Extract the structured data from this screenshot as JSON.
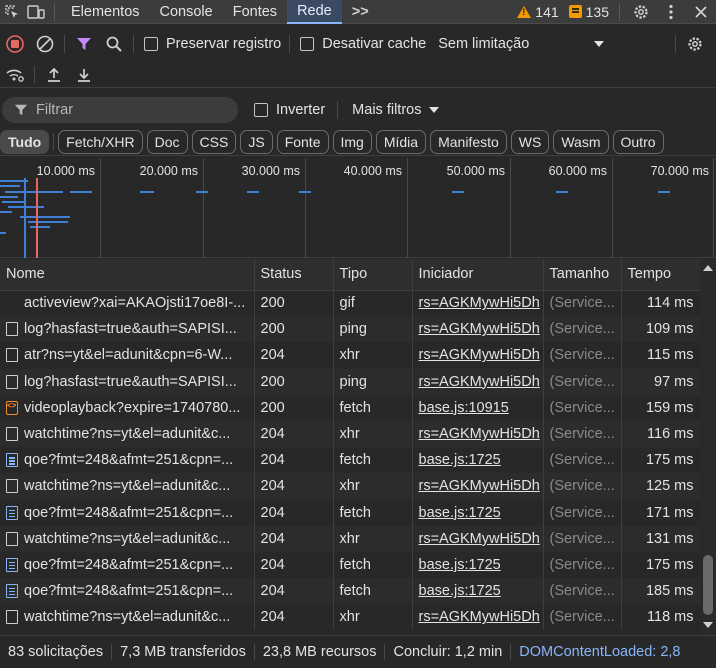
{
  "tabbar": {
    "tabs": [
      "Elementos",
      "Console",
      "Fontes",
      "Rede"
    ],
    "active_tab": "Rede",
    "more_tabs_symbol": ">>",
    "warnings_count": "141",
    "issues_count": "135"
  },
  "toolbar": {
    "preserve_log_label": "Preservar registro",
    "disable_cache_label": "Desativar cache",
    "throttling_value": "Sem limitação"
  },
  "filterbar": {
    "filter_placeholder": "Filtrar",
    "invert_label": "Inverter",
    "more_filters_label": "Mais filtros"
  },
  "type_filters": [
    "Tudo",
    "Fetch/XHR",
    "Doc",
    "CSS",
    "JS",
    "Fonte",
    "Img",
    "Mídia",
    "Manifesto",
    "WS",
    "Wasm",
    "Outro"
  ],
  "active_type_filter": "Tudo",
  "overview": {
    "tick_labels": [
      "10.000 ms",
      "20.000 ms",
      "30.000 ms",
      "40.000 ms",
      "50.000 ms",
      "60.000 ms",
      "70.000 ms"
    ]
  },
  "table": {
    "columns": [
      "Nome",
      "Status",
      "Tipo",
      "Iniciador",
      "Tamanho",
      "Tempo"
    ],
    "rows": [
      {
        "icon": "none",
        "name": "activeview?xai=AKAOjsti17oe8I-...",
        "status": "200",
        "type": "gif",
        "initiator": "rs=AGKMywHi5Dh",
        "size": "(Service...",
        "time": "114 ms"
      },
      {
        "icon": "file",
        "name": "log?hasfast=true&auth=SAPISI...",
        "status": "200",
        "type": "ping",
        "initiator": "rs=AGKMywHi5Dh",
        "size": "(Service...",
        "time": "109 ms"
      },
      {
        "icon": "file",
        "name": "atr?ns=yt&el=adunit&cpn=6-W...",
        "status": "204",
        "type": "xhr",
        "initiator": "rs=AGKMywHi5Dh",
        "size": "(Service...",
        "time": "115 ms"
      },
      {
        "icon": "file",
        "name": "log?hasfast=true&auth=SAPISI...",
        "status": "200",
        "type": "ping",
        "initiator": "rs=AGKMywHi5Dh",
        "size": "(Service...",
        "time": "97 ms"
      },
      {
        "icon": "media",
        "name": "videoplayback?expire=1740780...",
        "status": "200",
        "type": "fetch",
        "initiator": "base.js:10915",
        "size": "(Service...",
        "time": "159 ms"
      },
      {
        "icon": "file",
        "name": "watchtime?ns=yt&el=adunit&c...",
        "status": "204",
        "type": "xhr",
        "initiator": "rs=AGKMywHi5Dh",
        "size": "(Service...",
        "time": "116 ms"
      },
      {
        "icon": "doc",
        "name": "qoe?fmt=248&afmt=251&cpn=...",
        "status": "204",
        "type": "fetch",
        "initiator": "base.js:1725",
        "size": "(Service...",
        "time": "175 ms"
      },
      {
        "icon": "file",
        "name": "watchtime?ns=yt&el=adunit&c...",
        "status": "204",
        "type": "xhr",
        "initiator": "rs=AGKMywHi5Dh",
        "size": "(Service...",
        "time": "125 ms"
      },
      {
        "icon": "doc",
        "name": "qoe?fmt=248&afmt=251&cpn=...",
        "status": "204",
        "type": "fetch",
        "initiator": "base.js:1725",
        "size": "(Service...",
        "time": "171 ms"
      },
      {
        "icon": "file",
        "name": "watchtime?ns=yt&el=adunit&c...",
        "status": "204",
        "type": "xhr",
        "initiator": "rs=AGKMywHi5Dh",
        "size": "(Service...",
        "time": "131 ms"
      },
      {
        "icon": "doc",
        "name": "qoe?fmt=248&afmt=251&cpn=...",
        "status": "204",
        "type": "fetch",
        "initiator": "base.js:1725",
        "size": "(Service...",
        "time": "175 ms"
      },
      {
        "icon": "doc",
        "name": "qoe?fmt=248&afmt=251&cpn=...",
        "status": "204",
        "type": "fetch",
        "initiator": "base.js:1725",
        "size": "(Service...",
        "time": "185 ms"
      },
      {
        "icon": "file",
        "name": "watchtime?ns=yt&el=adunit&c...",
        "status": "204",
        "type": "xhr",
        "initiator": "rs=AGKMywHi5Dh",
        "size": "(Service...",
        "time": "118 ms"
      }
    ]
  },
  "statusbar": {
    "requests": "83 solicitações",
    "transferred": "7,3 MB transferidos",
    "resources": "23,8 MB recursos",
    "finish": "Concluir: 1,2 min",
    "dom_loaded": "DOMContentLoaded: 2,8"
  },
  "colors": {
    "accent": "#8ab4f8",
    "record": "#e46962",
    "filter_funnel": "#c58af9",
    "warning": "#f29900",
    "waterfall_bar": "#3f7fd6"
  }
}
